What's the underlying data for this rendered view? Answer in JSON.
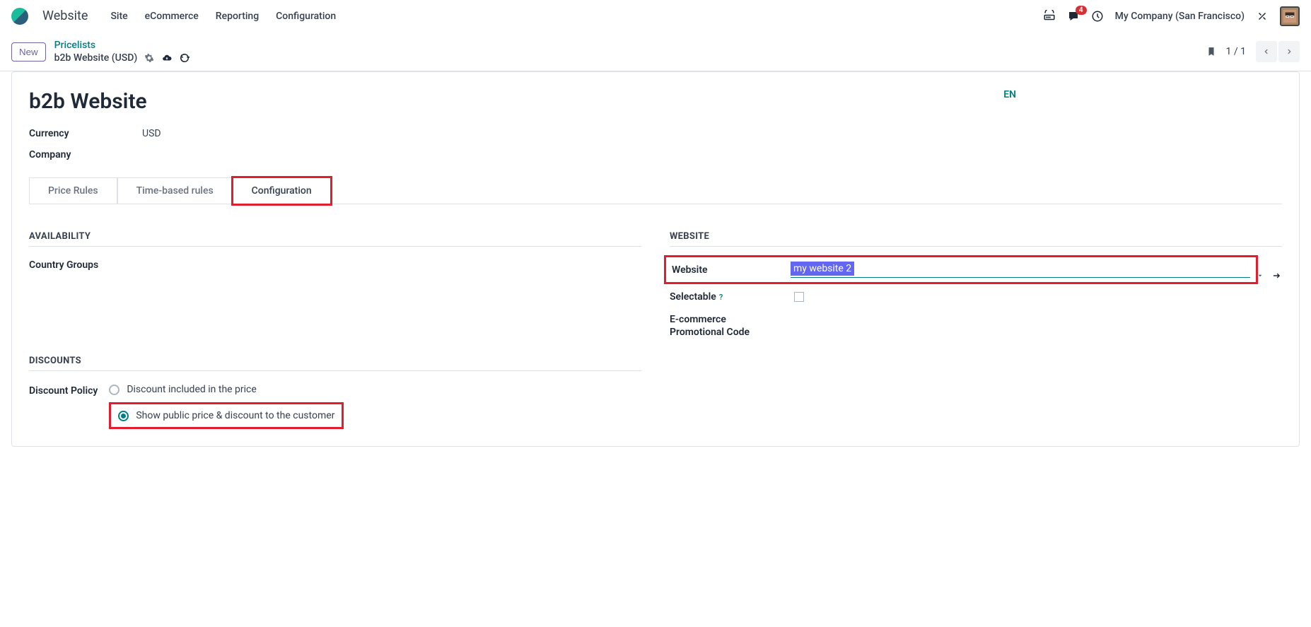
{
  "app_name": "Website",
  "nav": {
    "items": [
      "Site",
      "eCommerce",
      "Reporting",
      "Configuration"
    ]
  },
  "topbar": {
    "message_badge": "4",
    "company": "My Company (San Francisco)"
  },
  "breadcrumb": {
    "new_label": "New",
    "parent": "Pricelists",
    "current": "b2b Website (USD)"
  },
  "pager": {
    "text": "1 / 1"
  },
  "record": {
    "title": "b2b Website",
    "lang": "EN",
    "fields": {
      "currency_label": "Currency",
      "currency_value": "USD",
      "company_label": "Company"
    }
  },
  "tabs": [
    {
      "label": "Price Rules"
    },
    {
      "label": "Time-based rules"
    },
    {
      "label": "Configuration"
    }
  ],
  "sections": {
    "availability": {
      "title": "AVAILABILITY",
      "country_groups_label": "Country Groups"
    },
    "website": {
      "title": "WEBSITE",
      "website_label": "Website",
      "website_value": "my website 2",
      "selectable_label": "Selectable",
      "ecommerce_code_label_line1": "E-commerce",
      "ecommerce_code_label_line2": "Promotional Code"
    },
    "discounts": {
      "title": "DISCOUNTS",
      "policy_label": "Discount Policy",
      "option1": "Discount included in the price",
      "option2": "Show public price & discount to the customer"
    }
  }
}
